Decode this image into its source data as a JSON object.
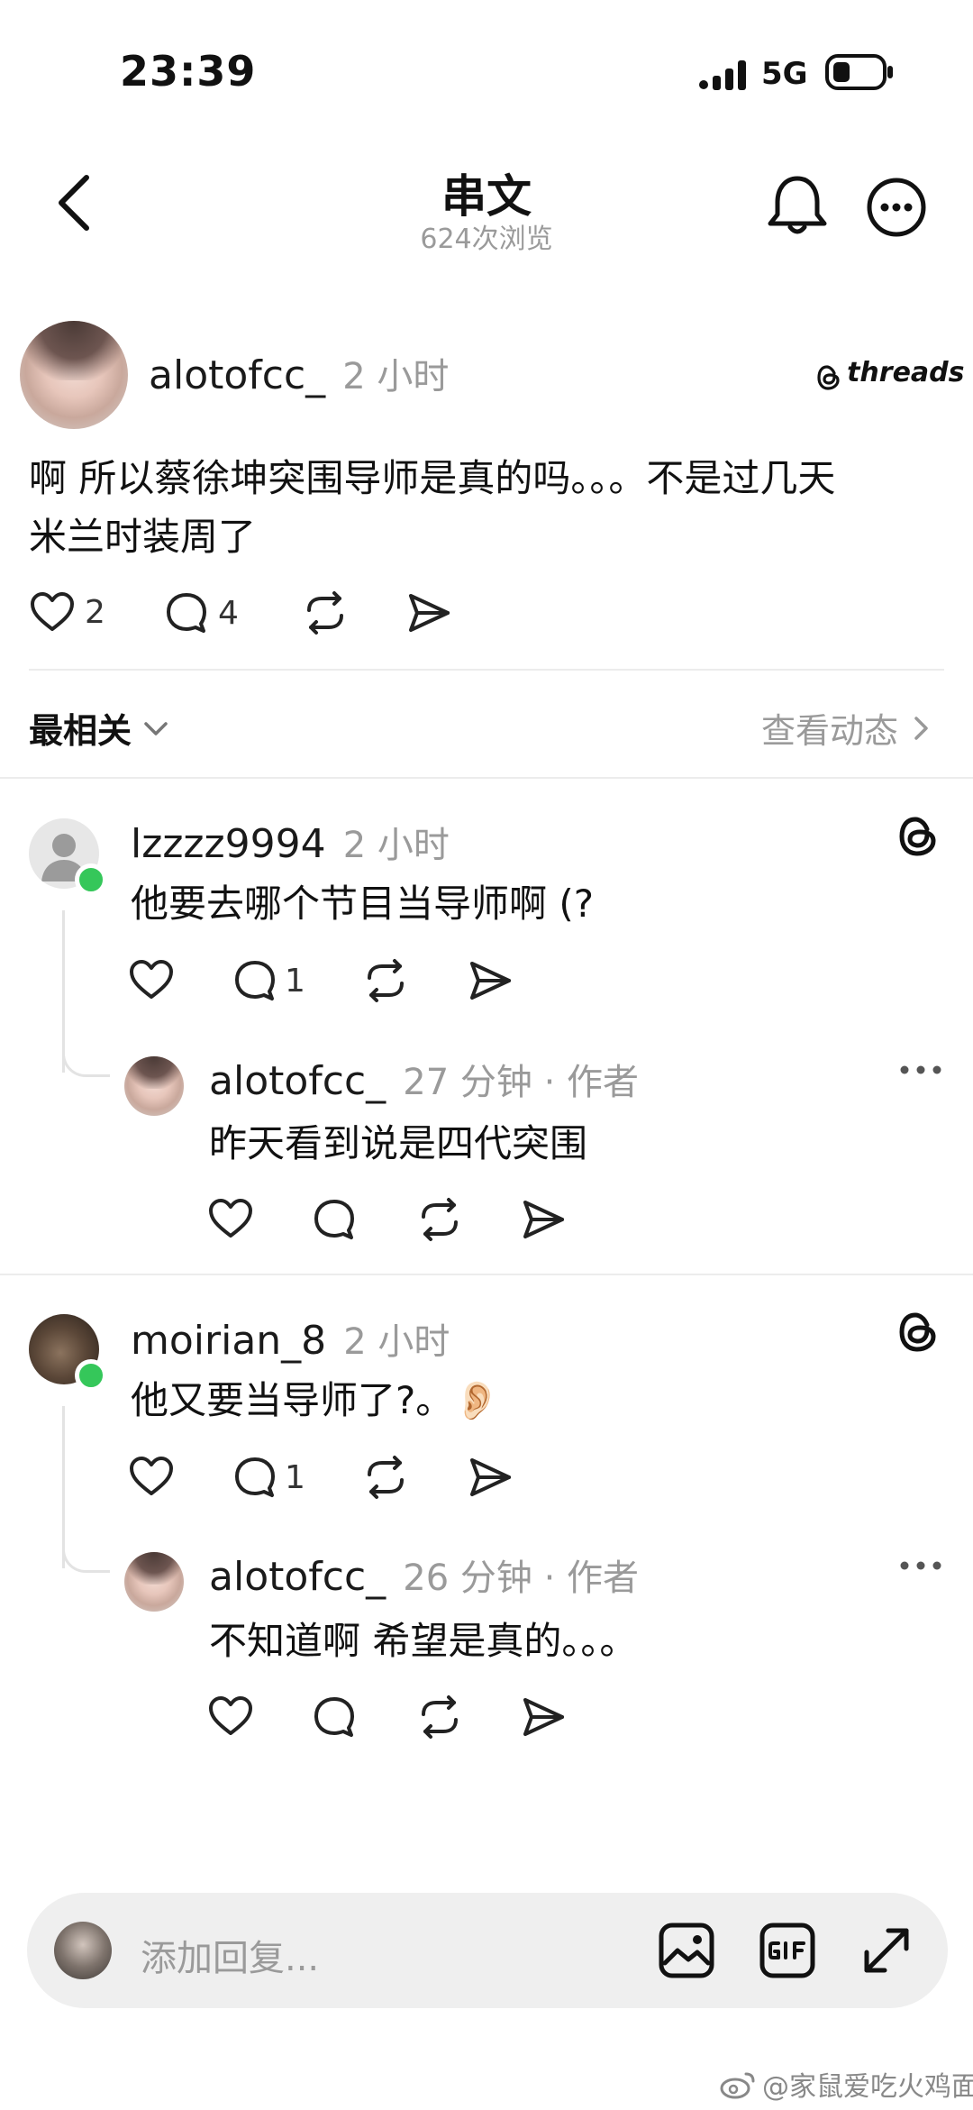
{
  "status_bar": {
    "time": "23:39",
    "network": "5G"
  },
  "header": {
    "title": "串文",
    "views": "624次浏览"
  },
  "post": {
    "username": "alotofcc_",
    "time": "2 小时",
    "brand": "threads",
    "text_line1": "啊 所以蔡徐坤突围导师是真的吗。。。不是过几天",
    "text_line2": "米兰时装周了",
    "likes": "2",
    "comments": "4"
  },
  "sort_bar": {
    "sort_label": "最相关",
    "activity_label": "查看动态"
  },
  "comments": [
    {
      "username": "lzzzz9994",
      "time": "2 小时",
      "text": "他要去哪个节目当导师啊 (?",
      "reply_count": "1",
      "reply": {
        "username": "alotofcc_",
        "meta": "27 分钟 · 作者",
        "text": "昨天看到说是四代突围"
      }
    },
    {
      "username": "moirian_8",
      "time": "2 小时",
      "text": "他又要当导师了?。👂🏻",
      "reply_count": "1",
      "reply": {
        "username": "alotofcc_",
        "meta": "26 分钟 · 作者",
        "text": "不知道啊 希望是真的。。。"
      }
    }
  ],
  "reply_bar": {
    "placeholder": "添加回复..."
  },
  "watermark": "@家鼠爱吃火鸡面",
  "colors": {
    "online": "#35c75a",
    "muted": "#9a9a9a",
    "divider": "#ececec",
    "reply_bar_bg": "#efefef"
  }
}
